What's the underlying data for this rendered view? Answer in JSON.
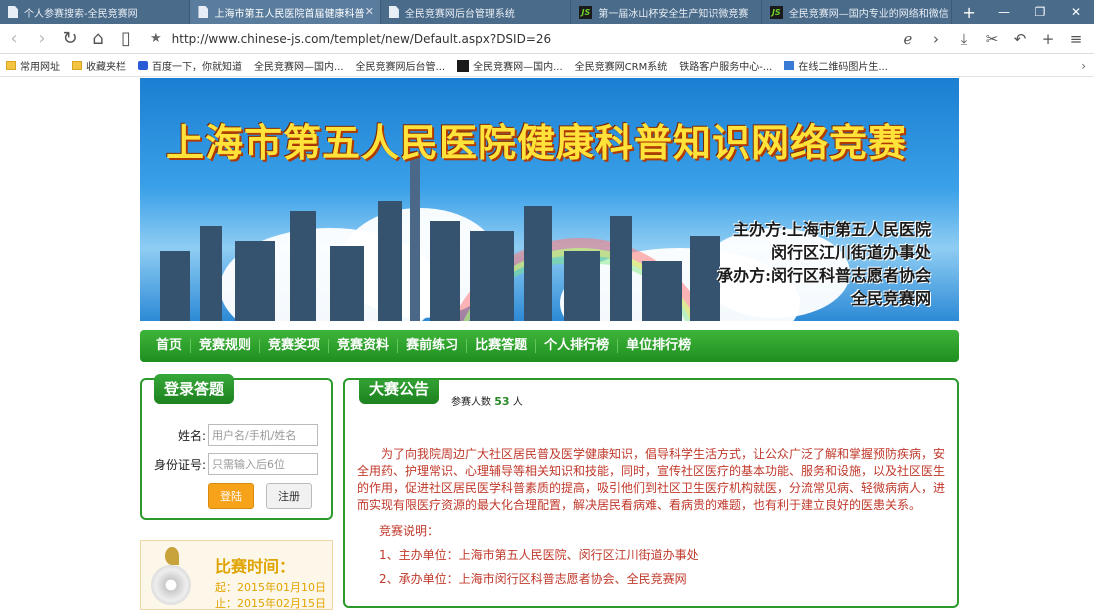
{
  "tabs": [
    {
      "title": "个人参赛搜索-全民竞赛网",
      "icon": "page-icon",
      "active": false
    },
    {
      "title": "上海市第五人民医院首届健康科普",
      "icon": "page-icon",
      "active": true
    },
    {
      "title": "全民竞赛网后台管理系统",
      "icon": "page-icon",
      "active": false
    },
    {
      "title": "第一届冰山杯安全生产知识微竞赛",
      "icon": "js-logo-icon",
      "active": false
    },
    {
      "title": "全民竞赛网—国内专业的网络和微信",
      "icon": "js-logo-icon",
      "active": false
    }
  ],
  "address": {
    "url": "http://www.chinese-js.com/templet/new/Default.aspx?DSID=26"
  },
  "bookmarks": [
    {
      "label": "常用网址",
      "icon": "folder-icon"
    },
    {
      "label": "收藏夹栏",
      "icon": "folder-icon"
    },
    {
      "label": "百度一下，你就知道",
      "icon": "baidu-icon"
    },
    {
      "label": "全民竞赛网—国内...",
      "icon": "page-icon"
    },
    {
      "label": "全民竞赛网后台管...",
      "icon": "page-icon"
    },
    {
      "label": "全民竞赛网—国内...",
      "icon": "js-logo-icon"
    },
    {
      "label": "全民竞赛网CRM系统",
      "icon": "page-icon"
    },
    {
      "label": "铁路客户服务中心-...",
      "icon": "page-icon"
    },
    {
      "label": "在线二维码图片生...",
      "icon": "qr-icon"
    }
  ],
  "banner": {
    "title": "上海市第五人民医院健康科普知识网络竞赛",
    "organizer_label": "主办方:",
    "organizer_1": "上海市第五人民医院",
    "organizer_2": "闵行区江川街道办事处",
    "co_label": "承办方:",
    "co_1": "闵行区科普志愿者协会",
    "co_2": "全民竞赛网"
  },
  "nav": [
    "首页",
    "竞赛规则",
    "竞赛奖项",
    "竞赛资料",
    "赛前练习",
    "比赛答题",
    "个人排行榜",
    "单位排行榜"
  ],
  "login": {
    "title": "登录答题",
    "name_label": "姓名:",
    "name_placeholder": "用户名/手机/姓名",
    "id_label": "身份证号:",
    "id_placeholder": "只需输入后6位",
    "login_button": "登陆",
    "register_button": "注册"
  },
  "time": {
    "title": "比赛时间：",
    "start": "起：2015年01月10日",
    "end": "止：2015年02月15日"
  },
  "announcement": {
    "title": "大赛公告",
    "participants_label": "参赛人数",
    "participants_count": "53",
    "participants_unit": "人",
    "intro": "为了向我院周边广大社区居民普及医学健康知识，倡导科学生活方式，让公众广泛了解和掌握预防疾病，安全用药、护理常识、心理辅导等相关知识和技能，同时，宣传社区医疗的基本功能、服务和设施，以及社区医生的作用，促进社区居民医学科普素质的提高，吸引他们到社区卫生医疗机构就医，分流常见病、轻微病病人，进而实现有限医疗资源的最大化合理配置，解决居民看病难、看病贵的难题，也有利于建立良好的医患关系。",
    "notes_title": "竞赛说明：",
    "item_1": "1、主办单位：上海市第五人民医院、闵行区江川街道办事处",
    "item_2": "2、承办单位：上海市闵行区科普志愿者协会、全民竞赛网"
  }
}
